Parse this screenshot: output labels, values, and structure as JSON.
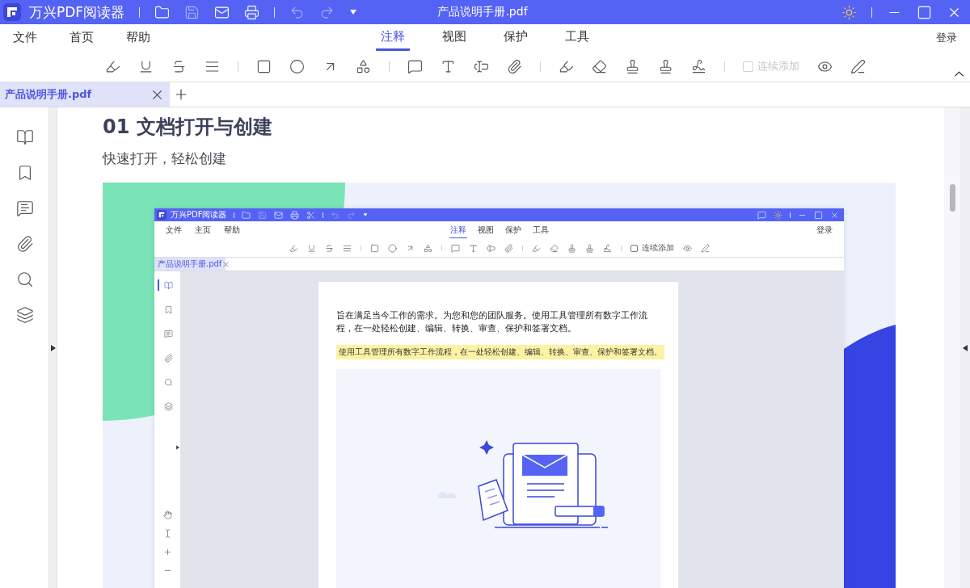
{
  "window": {
    "app_name": "万兴PDF阅读器",
    "title": "产品说明手册.pdf"
  },
  "menu": [
    "文件",
    "首页",
    "帮助"
  ],
  "ribbon_tabs": [
    {
      "label": "注释",
      "selected": true
    },
    {
      "label": "视图",
      "selected": false
    },
    {
      "label": "保护",
      "selected": false
    },
    {
      "label": "工具",
      "selected": false
    }
  ],
  "login": "登录",
  "continuous_add": {
    "label": "连续添加",
    "checked": false,
    "disabled": true
  },
  "doc_tabs": [
    {
      "label": "产品说明手册.pdf",
      "selected": true
    }
  ],
  "sidebar_buttons": [
    {
      "selected": false
    },
    {
      "selected": false
    },
    {
      "selected": false
    },
    {
      "selected": false
    },
    {
      "selected": false
    },
    {
      "selected": false
    }
  ],
  "page": {
    "heading": "01 文档打开与创建",
    "subheading": "快速打开，轻松创建",
    "inner_window": {
      "window": {
        "app_name": "万兴PDF阅读器"
      },
      "menu": [
        "文件",
        "主页",
        "帮助"
      ],
      "ribbon_tabs": [
        {
          "label": "注释",
          "selected": true
        },
        {
          "label": "视图",
          "selected": false
        },
        {
          "label": "保护",
          "selected": false
        },
        {
          "label": "工具",
          "selected": false
        }
      ],
      "login": "登录",
      "continuous_add": {
        "label": "连续添加",
        "checked": false,
        "disabled": false
      },
      "doc_tabs": [
        {
          "label": "产品说明手册.pdf",
          "selected": true
        }
      ],
      "sidebar_buttons": [
        {
          "selected": true
        },
        {
          "selected": false
        },
        {
          "selected": false
        },
        {
          "selected": false
        },
        {
          "selected": false
        },
        {
          "selected": false
        }
      ],
      "paragraph": "旨在满足当今工作的需求。为您和您的团队服务。使用工具管理所有数字工作流程，在一处轻松创建、编辑、转换、审查、保护和签署文档。",
      "highlight": "使用工具管理所有数字工作流程，在一处轻松创建、编辑、转换、审查、保护和签署文档。"
    }
  }
}
